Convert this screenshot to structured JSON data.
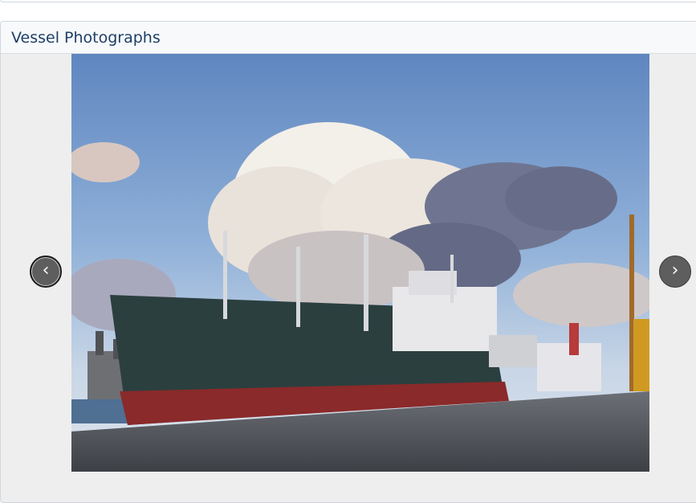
{
  "panel": {
    "title": "Vessel Photographs"
  },
  "carousel": {
    "prev_icon": "chevron-left-icon",
    "next_icon": "chevron-right-icon",
    "prev_glyph": "‹",
    "next_glyph": "›"
  },
  "colors": {
    "title": "#1f3f66",
    "header_bg": "#f7f9fb",
    "border": "#cfd6de",
    "nav_button": "#5e5e5e",
    "carousel_bg": "#eeeeee"
  }
}
